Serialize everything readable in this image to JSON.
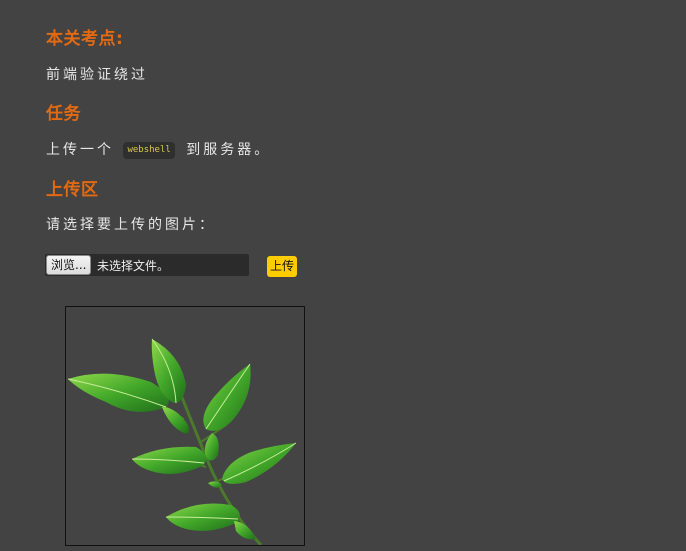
{
  "sections": {
    "checkpoint_heading": "本关考点:",
    "checkpoint_text": "前端验证绕过",
    "task_heading": "任务",
    "task_before": "上传一个",
    "task_code": "webshell",
    "task_after": "到服务器。",
    "upload_heading": "上传区",
    "upload_prompt": "请选择要上传的图片："
  },
  "file_input": {
    "browse_label": "浏览...",
    "status": "未选择文件。"
  },
  "upload_button": {
    "label": "上传"
  },
  "colors": {
    "background": "#434343",
    "heading": "#e26a12",
    "text": "#e6e6e6",
    "upload_button": "#ffcc00",
    "code_text": "#d9c84a"
  },
  "preview": {
    "icon": "leaf-branch-image"
  }
}
